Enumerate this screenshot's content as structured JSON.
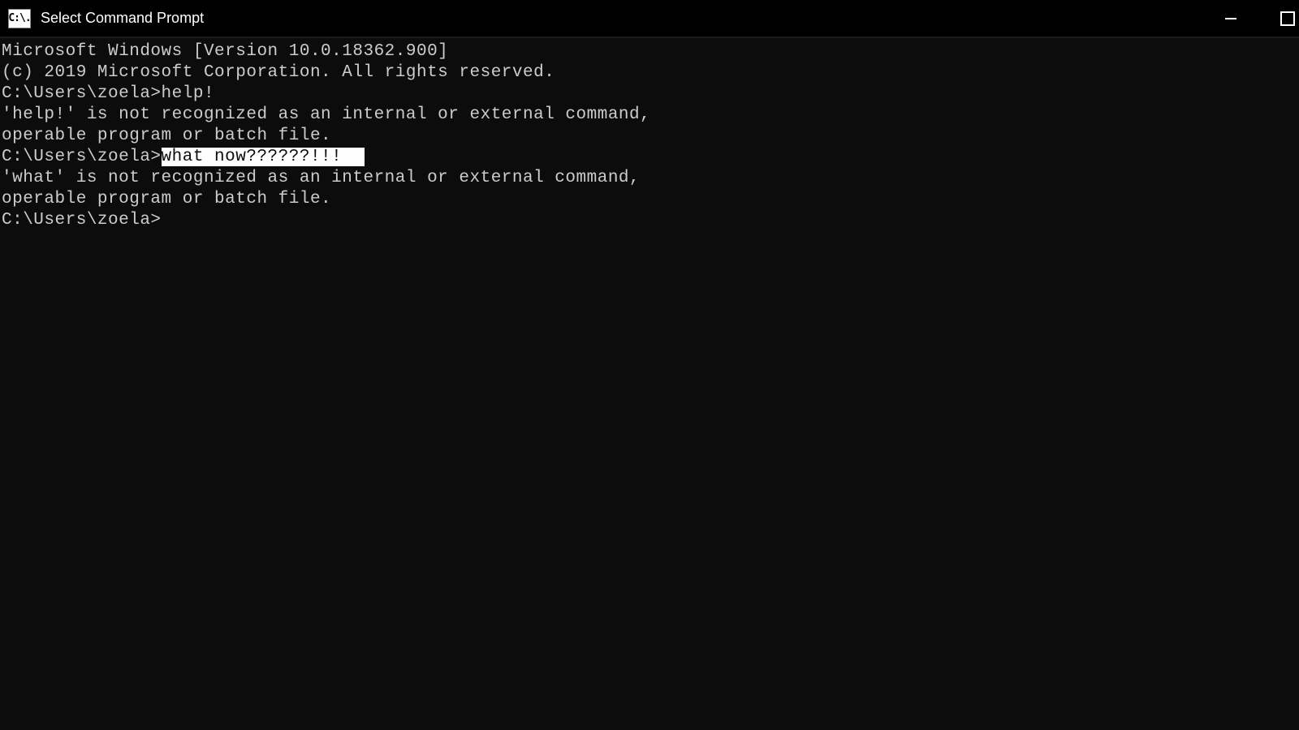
{
  "window": {
    "title": "Select Command Prompt",
    "icon_label": "C:\\."
  },
  "terminal": {
    "banner_line1": "Microsoft Windows [Version 10.0.18362.900]",
    "banner_line2": "(c) 2019 Microsoft Corporation. All rights reserved.",
    "blank": "",
    "prompt1": "C:\\Users\\zoela>",
    "cmd1": "help!",
    "err1_line1": "'help!' is not recognized as an internal or external command,",
    "err1_line2": "operable program or batch file.",
    "prompt2": "C:\\Users\\zoela>",
    "cmd2_selected": "what now??????!!!",
    "err2_line1": "'what' is not recognized as an internal or external command,",
    "err2_line2": "operable program or batch file.",
    "prompt3": "C:\\Users\\zoela>"
  }
}
